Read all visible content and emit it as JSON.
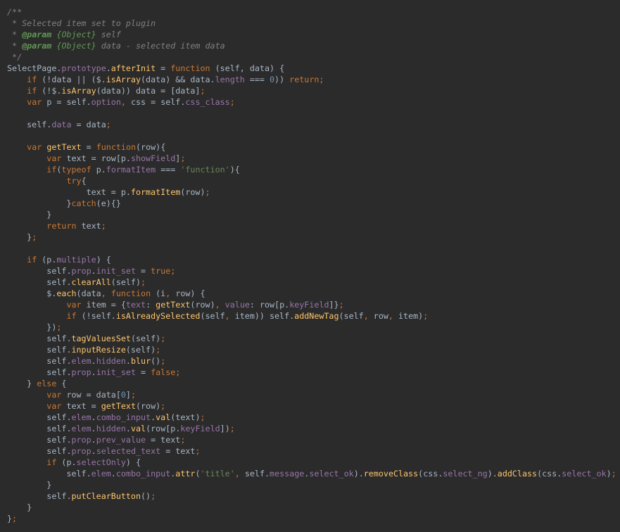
{
  "editor": {
    "language": "javascript",
    "theme": {
      "background": "#2b2b2b",
      "text": "#a9b7c6",
      "comment": "#808080",
      "doc_tag": "#629755",
      "keyword": "#cc7832",
      "property": "#9876aa",
      "function": "#ffc66d",
      "string": "#6a8759",
      "number": "#6897bb"
    },
    "lines": [
      [
        [
          "comment",
          "/**"
        ]
      ],
      [
        [
          "comment",
          " * Selected item set to plugin"
        ]
      ],
      [
        [
          "comment",
          " * "
        ],
        [
          "doctag",
          "@param"
        ],
        [
          "comment",
          " "
        ],
        [
          "doctype",
          "{Object}"
        ],
        [
          "comment",
          " self"
        ]
      ],
      [
        [
          "comment",
          " * "
        ],
        [
          "doctag",
          "@param"
        ],
        [
          "comment",
          " "
        ],
        [
          "doctype",
          "{Object}"
        ],
        [
          "comment",
          " data - selected item data"
        ]
      ],
      [
        [
          "comment",
          " */"
        ]
      ],
      [
        [
          "text",
          "SelectPage."
        ],
        [
          "prop",
          "prototype"
        ],
        [
          "text",
          "."
        ],
        [
          "func",
          "afterInit"
        ],
        [
          "text",
          " = "
        ],
        [
          "keyword",
          "function"
        ],
        [
          "text",
          " (self, data) {"
        ]
      ],
      [
        [
          "text",
          "    "
        ],
        [
          "keyword",
          "if"
        ],
        [
          "text",
          " (!data || ($."
        ],
        [
          "func",
          "isArray"
        ],
        [
          "text",
          "(data) && data."
        ],
        [
          "prop",
          "length"
        ],
        [
          "text",
          " === "
        ],
        [
          "number",
          "0"
        ],
        [
          "text",
          ")) "
        ],
        [
          "keyword",
          "return"
        ],
        [
          "punct",
          ";"
        ]
      ],
      [
        [
          "text",
          "    "
        ],
        [
          "keyword",
          "if"
        ],
        [
          "text",
          " (!$."
        ],
        [
          "func",
          "isArray"
        ],
        [
          "text",
          "(data)) data = [data]"
        ],
        [
          "punct",
          ";"
        ]
      ],
      [
        [
          "text",
          "    "
        ],
        [
          "keyword",
          "var"
        ],
        [
          "text",
          " p = self."
        ],
        [
          "prop",
          "option"
        ],
        [
          "punct",
          ","
        ],
        [
          "text",
          " css = self."
        ],
        [
          "prop",
          "css_class"
        ],
        [
          "punct",
          ";"
        ]
      ],
      [],
      [
        [
          "text",
          "    self."
        ],
        [
          "prop",
          "data"
        ],
        [
          "text",
          " = data"
        ],
        [
          "punct",
          ";"
        ]
      ],
      [],
      [
        [
          "text",
          "    "
        ],
        [
          "keyword",
          "var"
        ],
        [
          "text",
          " "
        ],
        [
          "func",
          "getText"
        ],
        [
          "text",
          " = "
        ],
        [
          "keyword",
          "function"
        ],
        [
          "text",
          "(row){"
        ]
      ],
      [
        [
          "text",
          "        "
        ],
        [
          "keyword",
          "var"
        ],
        [
          "text",
          " text = row[p."
        ],
        [
          "prop",
          "showField"
        ],
        [
          "text",
          "]"
        ],
        [
          "punct",
          ";"
        ]
      ],
      [
        [
          "text",
          "        "
        ],
        [
          "keyword",
          "if"
        ],
        [
          "text",
          "("
        ],
        [
          "keyword",
          "typeof"
        ],
        [
          "text",
          " p."
        ],
        [
          "prop",
          "formatItem"
        ],
        [
          "text",
          " === "
        ],
        [
          "string",
          "'function'"
        ],
        [
          "text",
          "){"
        ]
      ],
      [
        [
          "text",
          "            "
        ],
        [
          "keyword",
          "try"
        ],
        [
          "text",
          "{"
        ]
      ],
      [
        [
          "text",
          "                text = p."
        ],
        [
          "func",
          "formatItem"
        ],
        [
          "text",
          "(row)"
        ],
        [
          "punct",
          ";"
        ]
      ],
      [
        [
          "text",
          "            }"
        ],
        [
          "keyword",
          "catch"
        ],
        [
          "text",
          "(e){}"
        ]
      ],
      [
        [
          "text",
          "        }"
        ]
      ],
      [
        [
          "text",
          "        "
        ],
        [
          "keyword",
          "return"
        ],
        [
          "text",
          " text"
        ],
        [
          "punct",
          ";"
        ]
      ],
      [
        [
          "text",
          "    }"
        ],
        [
          "punct",
          ";"
        ]
      ],
      [],
      [
        [
          "text",
          "    "
        ],
        [
          "keyword",
          "if"
        ],
        [
          "text",
          " (p."
        ],
        [
          "prop",
          "multiple"
        ],
        [
          "text",
          ") {"
        ]
      ],
      [
        [
          "text",
          "        self."
        ],
        [
          "prop",
          "prop"
        ],
        [
          "text",
          "."
        ],
        [
          "prop",
          "init_set"
        ],
        [
          "text",
          " = "
        ],
        [
          "keyword",
          "true"
        ],
        [
          "punct",
          ";"
        ]
      ],
      [
        [
          "text",
          "        self."
        ],
        [
          "func",
          "clearAll"
        ],
        [
          "text",
          "(self)"
        ],
        [
          "punct",
          ";"
        ]
      ],
      [
        [
          "text",
          "        $."
        ],
        [
          "func",
          "each"
        ],
        [
          "text",
          "(data"
        ],
        [
          "punct",
          ","
        ],
        [
          "text",
          " "
        ],
        [
          "keyword",
          "function"
        ],
        [
          "text",
          " (i"
        ],
        [
          "punct",
          ","
        ],
        [
          "text",
          " row) {"
        ]
      ],
      [
        [
          "text",
          "            "
        ],
        [
          "keyword",
          "var"
        ],
        [
          "text",
          " item = {"
        ],
        [
          "prop",
          "text"
        ],
        [
          "text",
          ": "
        ],
        [
          "func",
          "getText"
        ],
        [
          "text",
          "(row)"
        ],
        [
          "punct",
          ","
        ],
        [
          "text",
          " "
        ],
        [
          "prop",
          "value"
        ],
        [
          "text",
          ": row[p."
        ],
        [
          "prop",
          "keyField"
        ],
        [
          "text",
          "]}"
        ],
        [
          "punct",
          ";"
        ]
      ],
      [
        [
          "text",
          "            "
        ],
        [
          "keyword",
          "if"
        ],
        [
          "text",
          " (!self."
        ],
        [
          "func",
          "isAlreadySelected"
        ],
        [
          "text",
          "(self"
        ],
        [
          "punct",
          ","
        ],
        [
          "text",
          " item)) self."
        ],
        [
          "func",
          "addNewTag"
        ],
        [
          "text",
          "(self"
        ],
        [
          "punct",
          ","
        ],
        [
          "text",
          " row"
        ],
        [
          "punct",
          ","
        ],
        [
          "text",
          " item)"
        ],
        [
          "punct",
          ";"
        ]
      ],
      [
        [
          "text",
          "        })"
        ],
        [
          "punct",
          ";"
        ]
      ],
      [
        [
          "text",
          "        self."
        ],
        [
          "func",
          "tagValuesSet"
        ],
        [
          "text",
          "(self)"
        ],
        [
          "punct",
          ";"
        ]
      ],
      [
        [
          "text",
          "        self."
        ],
        [
          "func",
          "inputResize"
        ],
        [
          "text",
          "(self)"
        ],
        [
          "punct",
          ";"
        ]
      ],
      [
        [
          "text",
          "        self."
        ],
        [
          "prop",
          "elem"
        ],
        [
          "text",
          "."
        ],
        [
          "prop",
          "hidden"
        ],
        [
          "text",
          "."
        ],
        [
          "func",
          "blur"
        ],
        [
          "text",
          "()"
        ],
        [
          "punct",
          ";"
        ]
      ],
      [
        [
          "text",
          "        self."
        ],
        [
          "prop",
          "prop"
        ],
        [
          "text",
          "."
        ],
        [
          "prop",
          "init_set"
        ],
        [
          "text",
          " = "
        ],
        [
          "keyword",
          "false"
        ],
        [
          "punct",
          ";"
        ]
      ],
      [
        [
          "text",
          "    } "
        ],
        [
          "keyword",
          "else"
        ],
        [
          "text",
          " {"
        ]
      ],
      [
        [
          "text",
          "        "
        ],
        [
          "keyword",
          "var"
        ],
        [
          "text",
          " row = data["
        ],
        [
          "number",
          "0"
        ],
        [
          "text",
          "]"
        ],
        [
          "punct",
          ";"
        ]
      ],
      [
        [
          "text",
          "        "
        ],
        [
          "keyword",
          "var"
        ],
        [
          "text",
          " text = "
        ],
        [
          "func",
          "getText"
        ],
        [
          "text",
          "(row)"
        ],
        [
          "punct",
          ";"
        ]
      ],
      [
        [
          "text",
          "        self."
        ],
        [
          "prop",
          "elem"
        ],
        [
          "text",
          "."
        ],
        [
          "prop",
          "combo_input"
        ],
        [
          "text",
          "."
        ],
        [
          "func",
          "val"
        ],
        [
          "text",
          "(text)"
        ],
        [
          "punct",
          ";"
        ]
      ],
      [
        [
          "text",
          "        self."
        ],
        [
          "prop",
          "elem"
        ],
        [
          "text",
          "."
        ],
        [
          "prop",
          "hidden"
        ],
        [
          "text",
          "."
        ],
        [
          "func",
          "val"
        ],
        [
          "text",
          "(row[p."
        ],
        [
          "prop",
          "keyField"
        ],
        [
          "text",
          "])"
        ],
        [
          "punct",
          ";"
        ]
      ],
      [
        [
          "text",
          "        self."
        ],
        [
          "prop",
          "prop"
        ],
        [
          "text",
          "."
        ],
        [
          "prop",
          "prev_value"
        ],
        [
          "text",
          " = text"
        ],
        [
          "punct",
          ";"
        ]
      ],
      [
        [
          "text",
          "        self."
        ],
        [
          "prop",
          "prop"
        ],
        [
          "text",
          "."
        ],
        [
          "prop",
          "selected_text"
        ],
        [
          "text",
          " = text"
        ],
        [
          "punct",
          ";"
        ]
      ],
      [
        [
          "text",
          "        "
        ],
        [
          "keyword",
          "if"
        ],
        [
          "text",
          " (p."
        ],
        [
          "prop",
          "selectOnly"
        ],
        [
          "text",
          ") {"
        ]
      ],
      [
        [
          "text",
          "            self."
        ],
        [
          "prop",
          "elem"
        ],
        [
          "text",
          "."
        ],
        [
          "prop",
          "combo_input"
        ],
        [
          "text",
          "."
        ],
        [
          "func",
          "attr"
        ],
        [
          "text",
          "("
        ],
        [
          "string",
          "'title'"
        ],
        [
          "punct",
          ","
        ],
        [
          "text",
          " self."
        ],
        [
          "prop",
          "message"
        ],
        [
          "text",
          "."
        ],
        [
          "prop",
          "select_ok"
        ],
        [
          "text",
          ")."
        ],
        [
          "func",
          "removeClass"
        ],
        [
          "text",
          "(css."
        ],
        [
          "prop",
          "select_ng"
        ],
        [
          "text",
          ")."
        ],
        [
          "func",
          "addClass"
        ],
        [
          "text",
          "(css."
        ],
        [
          "prop",
          "select_ok"
        ],
        [
          "text",
          ")"
        ],
        [
          "punct",
          ";"
        ]
      ],
      [
        [
          "text",
          "        }"
        ]
      ],
      [
        [
          "text",
          "        self."
        ],
        [
          "func",
          "putClearButton"
        ],
        [
          "text",
          "()"
        ],
        [
          "punct",
          ";"
        ]
      ],
      [
        [
          "text",
          "    }"
        ]
      ],
      [
        [
          "text",
          "}"
        ],
        [
          "punct",
          ";"
        ]
      ]
    ]
  }
}
